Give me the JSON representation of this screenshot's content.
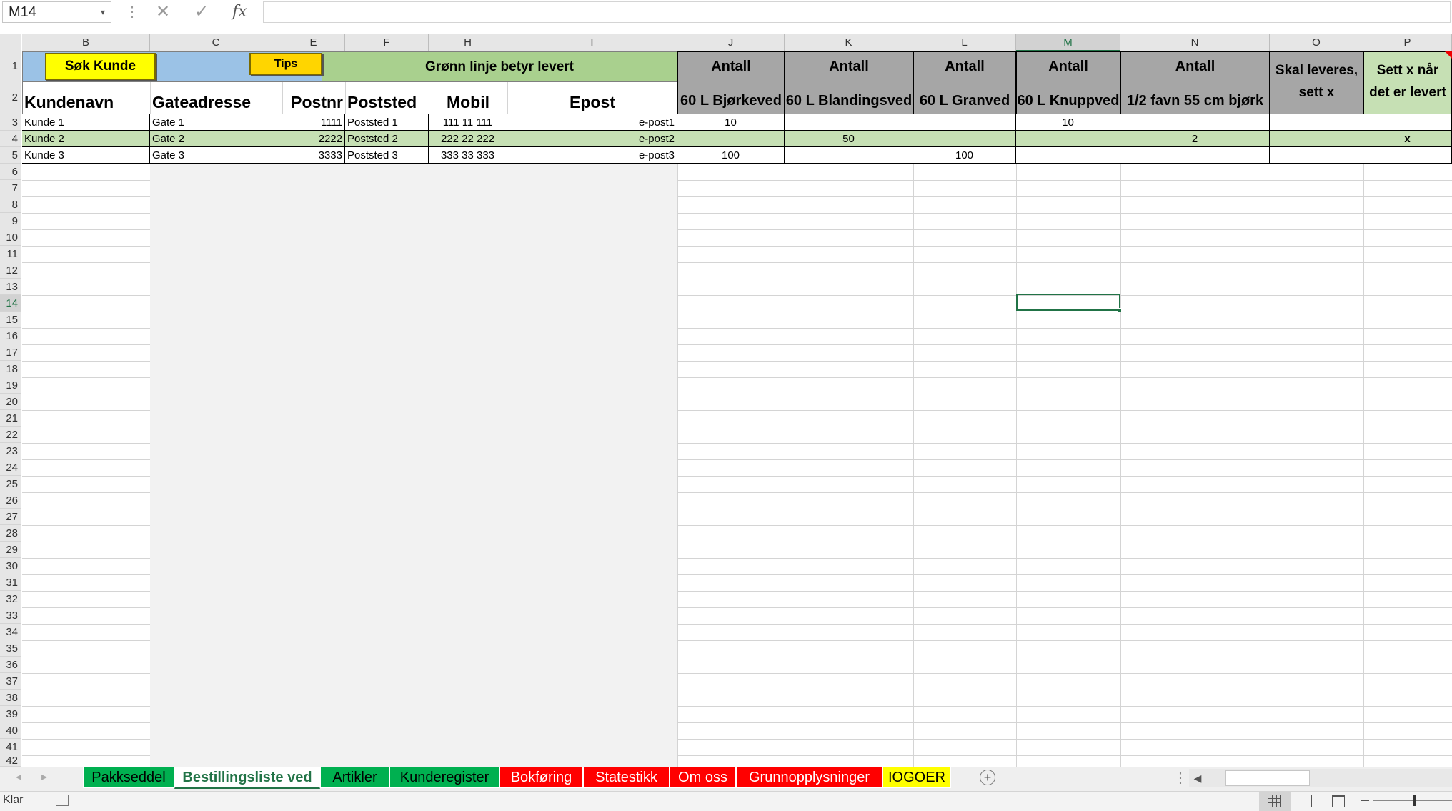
{
  "formula_bar": {
    "name_box": "M14",
    "cancel_icon": "✕",
    "enter_icon": "✓",
    "fx_label": "fx"
  },
  "columns": [
    "B",
    "C",
    "E",
    "F",
    "H",
    "I",
    "J",
    "K",
    "L",
    "M",
    "N",
    "O",
    "P"
  ],
  "selected_cell": "M14",
  "rows": [
    "1",
    "2",
    "3",
    "4",
    "5",
    "6",
    "7",
    "8",
    "9",
    "10",
    "11",
    "12",
    "13",
    "14",
    "15",
    "16",
    "17",
    "18",
    "19",
    "20",
    "21",
    "22",
    "23",
    "24",
    "25",
    "26",
    "27",
    "28",
    "29",
    "30",
    "31",
    "32",
    "33",
    "34",
    "35",
    "36",
    "37",
    "38",
    "39",
    "40",
    "41",
    "42"
  ],
  "buttons": {
    "search_customer": "Søk Kunde",
    "tips": "Tips"
  },
  "banner": "Grønn linje betyr levert",
  "headers": {
    "customer_name": "Kundenavn",
    "street": "Gateadresse",
    "postal_code": "Postnr",
    "city": "Poststed",
    "mobile": "Mobil",
    "email": "Epost",
    "qty_label": "Antall",
    "products": [
      "60 L Bjørkeved",
      "60 L Blandingsved",
      "60 L Granved",
      "60 L Knuppved",
      "1/2 favn 55 cm bjørk"
    ],
    "to_deliver": [
      "Skal leveres,",
      "sett x"
    ],
    "mark_delivered": [
      "Sett x når",
      "det er levert"
    ]
  },
  "orders": [
    {
      "name": "Kunde 1",
      "street": "Gate 1",
      "postal": "1111",
      "city": "Poststed 1",
      "mobile": "111 11 111",
      "email": "e-post1",
      "bjork": "10",
      "bland": "",
      "gran": "",
      "knupp": "10",
      "favn": "",
      "to_deliver": "",
      "delivered": "",
      "is_delivered": false
    },
    {
      "name": "Kunde 2",
      "street": "Gate 2",
      "postal": "2222",
      "city": "Poststed 2",
      "mobile": "222 22 222",
      "email": "e-post2",
      "bjork": "",
      "bland": "50",
      "gran": "",
      "knupp": "",
      "favn": "2",
      "to_deliver": "",
      "delivered": "x",
      "is_delivered": true
    },
    {
      "name": "Kunde 3",
      "street": "Gate 3",
      "postal": "3333",
      "city": "Poststed 3",
      "mobile": "333 33 333",
      "email": "e-post3",
      "bjork": "100",
      "bland": "",
      "gran": "100",
      "knupp": "",
      "favn": "",
      "to_deliver": "",
      "delivered": "",
      "is_delivered": false
    }
  ],
  "sheet_tabs": [
    {
      "label": "Pakkseddel",
      "color": "#00b050",
      "active": false
    },
    {
      "label": "Bestillingsliste ved",
      "color": "#ffffff",
      "active": true
    },
    {
      "label": "Artikler",
      "color": "#00b050",
      "active": false
    },
    {
      "label": "Kunderegister",
      "color": "#00b050",
      "active": false
    },
    {
      "label": "Bokføring",
      "color": "#ff0000",
      "active": false
    },
    {
      "label": "Statestikk",
      "color": "#ff0000",
      "active": false
    },
    {
      "label": "Om oss",
      "color": "#ff0000",
      "active": false
    },
    {
      "label": "Grunnopplysninger",
      "color": "#ff0000",
      "active": false
    },
    {
      "label": "IOGOER",
      "color": "#ffff00",
      "active": false
    }
  ],
  "status": {
    "ready": "Klar"
  },
  "colors": {
    "header_gray": "#a6a6a6",
    "banner_green": "#a9d08e",
    "banner_blue": "#9bc2e6",
    "delivered_row": "#c6e0b4",
    "side_gray": "#f2f2f2",
    "accent": "#217346"
  }
}
